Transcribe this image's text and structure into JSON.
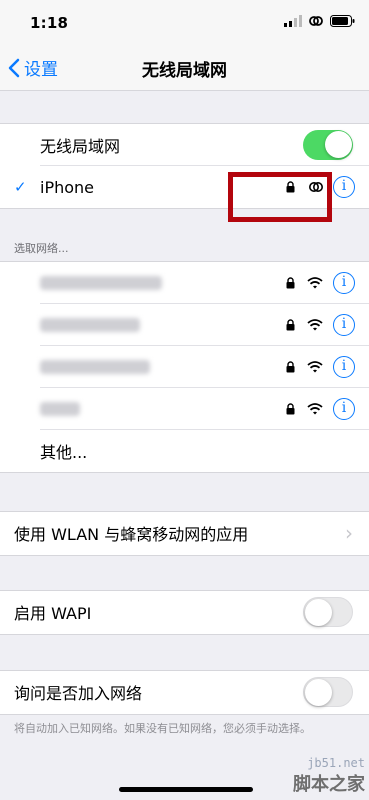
{
  "status": {
    "time": "1:18"
  },
  "nav": {
    "back_label": "设置",
    "title": "无线局域网"
  },
  "wifi_toggle": {
    "label": "无线局域网",
    "state": "on"
  },
  "connected": {
    "name": "iPhone",
    "checkmark": "✓",
    "info": "i"
  },
  "networks_header": "选取网络...",
  "networks": [
    {
      "icon_lock": "lock-icon",
      "icon_wifi": "wifi-icon",
      "info": "i"
    },
    {
      "icon_lock": "lock-icon",
      "icon_wifi": "wifi-icon",
      "info": "i"
    },
    {
      "icon_lock": "lock-icon",
      "icon_wifi": "wifi-icon",
      "info": "i"
    },
    {
      "icon_lock": "lock-icon",
      "icon_wifi": "wifi-icon",
      "info": "i"
    }
  ],
  "other_label": "其他...",
  "wlan_cellular": {
    "label": "使用 WLAN 与蜂窝移动网的应用",
    "chevron": "›"
  },
  "wapi": {
    "label": "启用 WAPI",
    "state": "off"
  },
  "ask_join": {
    "label": "询问是否加入网络",
    "state": "off"
  },
  "footnote": "将自动加入已知网络。如果没有已知网络，您必须手动选择。",
  "watermark": {
    "site": "jb51.net",
    "name": "脚本之家"
  },
  "colors": {
    "accent": "#0a7aff",
    "toggle_on": "#4cd964",
    "highlight_box": "#b3050d"
  }
}
